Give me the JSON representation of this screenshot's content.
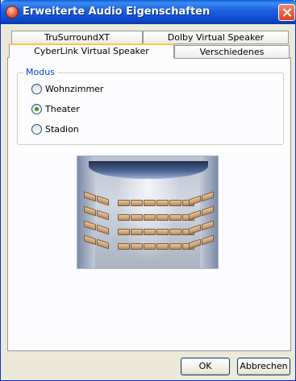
{
  "window": {
    "title": "Erweiterte Audio Eigenschaften"
  },
  "tabs": {
    "row_back": [
      {
        "label": "TruSurroundXT"
      },
      {
        "label": "Dolby Virtual Speaker"
      }
    ],
    "row_front": [
      {
        "label": "CyberLink Virtual Speaker",
        "active": true
      },
      {
        "label": "Verschiedenes",
        "active": false
      }
    ]
  },
  "mode_group": {
    "label": "Modus",
    "options": [
      {
        "label": "Wohnzimmer",
        "checked": false
      },
      {
        "label": "Theater",
        "checked": true
      },
      {
        "label": "Stadion",
        "checked": false
      }
    ]
  },
  "preview": {
    "icon": "theater-illustration"
  },
  "buttons": {
    "ok_label": "OK",
    "cancel_label": "Abbrechen"
  },
  "colors": {
    "titlebar": "#0a47c7",
    "group_label": "#0046d5",
    "active_tab_accent": "#ffc83c",
    "radio_dot": "#21a121"
  }
}
